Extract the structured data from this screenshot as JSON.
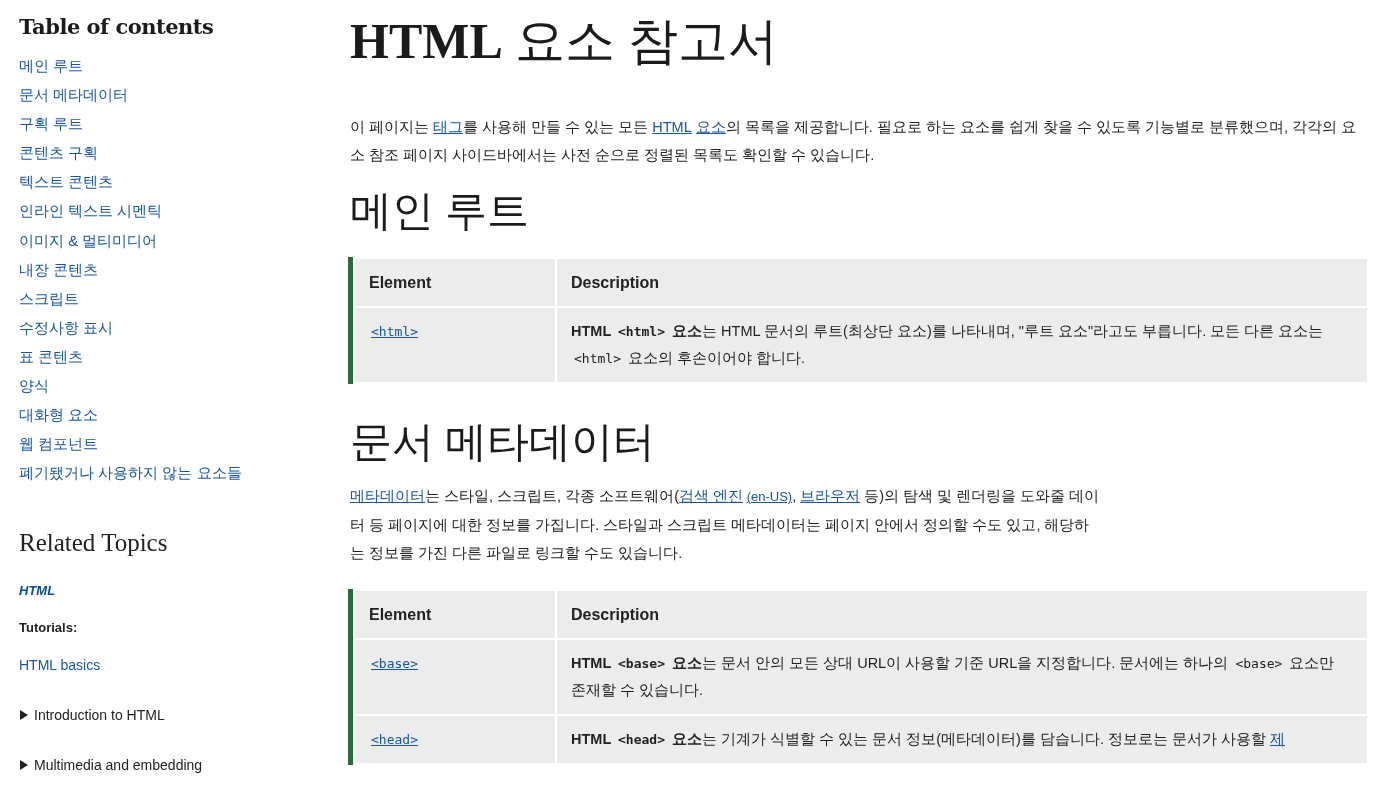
{
  "sidebar": {
    "toc_title": "Table of contents",
    "toc": [
      "메인 루트",
      "문서 메타데이터",
      "구획 루트",
      "콘텐츠 구획",
      "텍스트 콘텐츠",
      "인라인 텍스트 시멘틱",
      "이미지 & 멀티미디어",
      "내장 콘텐츠",
      "스크립트",
      "수정사항 표시",
      "표 콘텐츠",
      "양식",
      "대화형 요소",
      "웹 컴포넌트",
      "폐기됐거나 사용하지 않는 요소들"
    ],
    "related_title": "Related Topics",
    "related": [
      {
        "kind": "topic",
        "text": "HTML"
      },
      {
        "kind": "heading",
        "text": "Tutorials:"
      },
      {
        "kind": "link",
        "text": "HTML basics"
      },
      {
        "kind": "toggle",
        "text": "Introduction to HTML",
        "expanded": false
      },
      {
        "kind": "toggle",
        "text": "Multimedia and embedding",
        "expanded": false
      }
    ]
  },
  "page": {
    "title": "**HTML** 요소 참고서",
    "intro": [
      {
        "kind": "text",
        "text": "이 페이지는 "
      },
      {
        "kind": "link",
        "text": "태그"
      },
      {
        "kind": "text",
        "text": "를 사용해 만들 수 있는 모든 "
      },
      {
        "kind": "link",
        "text": "HTML"
      },
      {
        "kind": "link",
        "text": "요소"
      },
      {
        "kind": "text",
        "text": "의 목록을 제공합니다. 필요로 하는 요소를 쉽게 찾을 수 있도록 기능별로 분류했으며, 각각의 요소 참조 페이지 사이드바에서는 사전 순으로 정렬된 목록도 확인할 수 있습니다."
      }
    ],
    "sections": [
      {
        "heading": "메인 루트",
        "columns": [
          "Element",
          "Description"
        ],
        "rows": [
          {
            "element": "<html>",
            "description": [
              {
                "kind": "bold",
                "text": "HTML "
              },
              {
                "kind": "boldcode",
                "text": "<html>"
              },
              {
                "kind": "bold",
                "text": " 요소"
              },
              {
                "kind": "text",
                "text": "는 HTML 문서의 루트(최상단 요소)를 나타내며, \"루트 요소\"라고도 부릅니다. 모든 다른 요소는 "
              },
              {
                "kind": "code",
                "text": "<html>"
              },
              {
                "kind": "text",
                "text": " 요소의 후손이어야 합니다."
              }
            ]
          }
        ]
      },
      {
        "heading": "문서 메타데이터",
        "paragraph": [
          {
            "kind": "link",
            "text": "메타데이터"
          },
          {
            "kind": "text",
            "text": "는 스타일, 스크립트, 각종 소프트웨어("
          },
          {
            "kind": "link",
            "text": "검색 엔진"
          },
          {
            "kind": "small-link",
            "text": "(en-US)"
          },
          {
            "kind": "text",
            "text": ", "
          },
          {
            "kind": "link",
            "text": "브라우저"
          },
          {
            "kind": "text",
            "text": " 등)의 탐색 및 렌더링을 도와줄 데이터 등 페이지에 대한 정보를 가집니다. 스타일과 스크립트 메타데이터는 페이지 안에서 정의할 수도 있고, 해당하는 정보를 가진 다른 파일로 링크할 수도 있습니다."
          }
        ],
        "columns": [
          "Element",
          "Description"
        ],
        "rows": [
          {
            "element": "<base>",
            "description": [
              {
                "kind": "bold",
                "text": "HTML "
              },
              {
                "kind": "boldcode",
                "text": "<base>"
              },
              {
                "kind": "bold",
                "text": " 요소"
              },
              {
                "kind": "text",
                "text": "는 문서 안의 모든 상대 URL이 사용할 기준 URL을 지정합니다. 문서에는 하나의 "
              },
              {
                "kind": "code",
                "text": "<base>"
              },
              {
                "kind": "text",
                "text": " 요소만 존재할 수 있습니다."
              }
            ]
          },
          {
            "element": "<head>",
            "description": [
              {
                "kind": "bold",
                "text": "HTML "
              },
              {
                "kind": "boldcode",
                "text": "<head>"
              },
              {
                "kind": "bold",
                "text": " 요소"
              },
              {
                "kind": "text",
                "text": "는 기계가 식별할 수 있는 문서 정보(메타데이터)를 담습니다. 정보로는 문서가 사용할 "
              },
              {
                "kind": "link",
                "text": "제"
              }
            ]
          }
        ]
      }
    ]
  }
}
